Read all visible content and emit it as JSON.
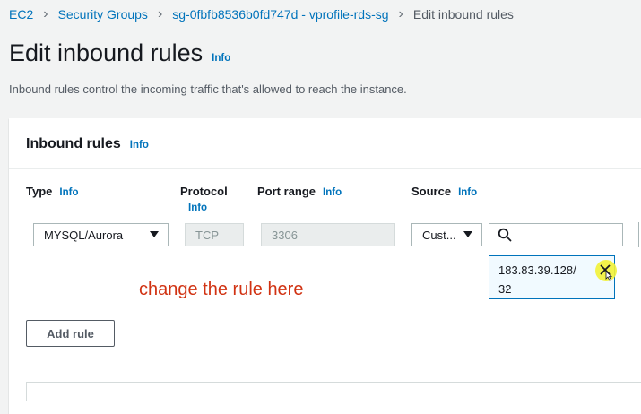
{
  "breadcrumb": {
    "items": [
      "EC2",
      "Security Groups",
      "sg-0fbfb8536b0fd747d - vprofile-rds-sg"
    ],
    "current": "Edit inbound rules"
  },
  "page": {
    "title": "Edit inbound rules",
    "info": "Info",
    "description": "Inbound rules control the incoming traffic that's allowed to reach the instance."
  },
  "panel": {
    "title": "Inbound rules",
    "info": "Info",
    "columns": {
      "type": "Type",
      "protocol": "Protocol",
      "port_range": "Port range",
      "source": "Source",
      "info": "Info"
    }
  },
  "rule": {
    "type": "MYSQL/Aurora",
    "protocol": "TCP",
    "port_range": "3306",
    "source_type": "Cust...",
    "source_cidr_line1": "183.83.39.128/",
    "source_cidr_line2": "32"
  },
  "annotation": "change the rule here",
  "add_rule_label": "Add rule",
  "icons": [
    "chevron-right-icon",
    "caret-down-icon",
    "search-icon",
    "remove-icon",
    "cursor-icon"
  ],
  "colors": {
    "link": "#0073bb",
    "annotation": "#d13212",
    "highlight": "#f2f237"
  }
}
